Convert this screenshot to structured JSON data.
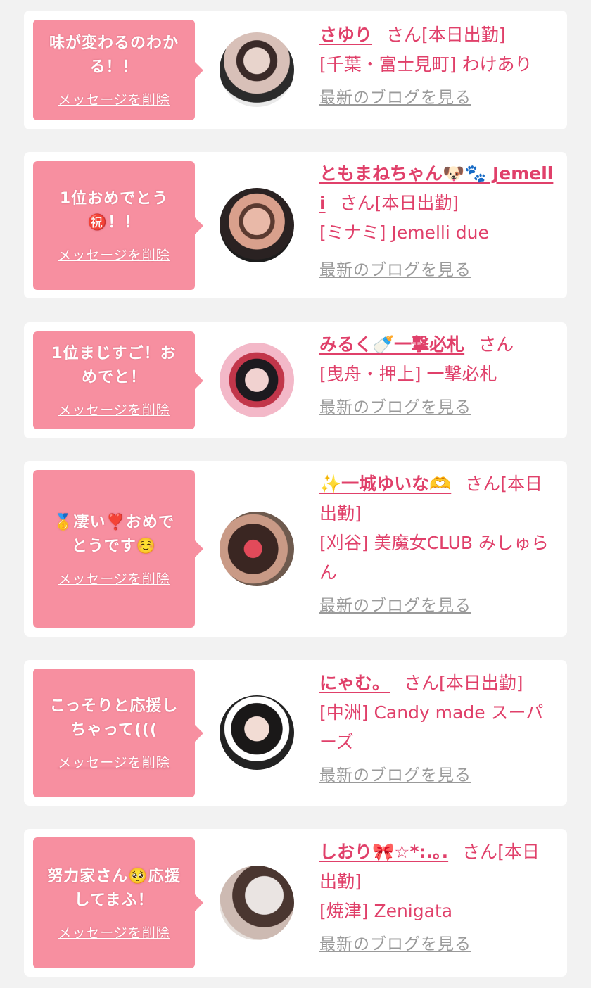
{
  "messages": [
    {
      "message_lines": [
        "味が変わるのわか",
        "る！！"
      ],
      "delete_label": "メッセージを削除",
      "name": "さゆり",
      "suffix": "さん[本日出勤]",
      "shop": "[千葉・富士見町] わけあり",
      "blog_link": "最新のブログを見る"
    },
    {
      "message_lines": [
        "1位おめでとう",
        "㊗️！！"
      ],
      "delete_label": "メッセージを削除",
      "name": "ともまねちゃん🐶🐾 Jemelli",
      "suffix": "さん[本日出勤]",
      "shop": "[ミナミ] Jemelli due",
      "blog_link": "最新のブログを見る"
    },
    {
      "message_lines": [
        "1位まじすご！お",
        "めでと！"
      ],
      "delete_label": "メッセージを削除",
      "name": "みるく🍼一撃必札",
      "suffix": "さん",
      "shop": "[曳舟・押上] 一撃必札",
      "blog_link": "最新のブログを見る"
    },
    {
      "message_lines": [
        "🥇凄い❣️おめで",
        "とうです☺️"
      ],
      "delete_label": "メッセージを削除",
      "name": "✨一城ゆいな🫶",
      "suffix": "さん[本日出勤]",
      "shop": "[刈谷] 美魔女CLUB みしゅらん",
      "blog_link": "最新のブログを見る"
    },
    {
      "message_lines": [
        "こっそりと応援し",
        "ちゃって((("
      ],
      "delete_label": "メッセージを削除",
      "name": "にゃむ。",
      "suffix": "さん[本日出勤]",
      "shop": "[中洲] Candy made スーパーズ",
      "blog_link": "最新のブログを見る"
    },
    {
      "message_lines": [
        "努力家さん🥺応援",
        "してまふ！"
      ],
      "delete_label": "メッセージを削除",
      "name": "しおり🎀☆*:.｡.",
      "suffix": "さん[本日出勤]",
      "shop": "[焼津] Zenigata",
      "blog_link": "最新のブログを見る"
    }
  ],
  "colors": {
    "page_bg": "#f2f2f2",
    "card_bg": "#ffffff",
    "bubble_bg": "#f78fa0",
    "name_text": "#e0406a",
    "blog_link": "#9a9a9a"
  }
}
